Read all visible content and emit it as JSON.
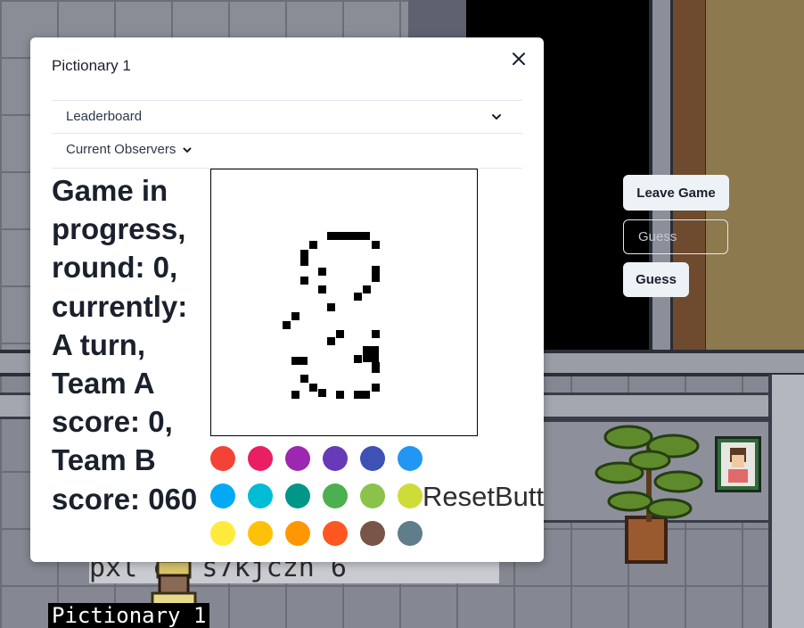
{
  "modal": {
    "title": "Pictionary 1",
    "close_icon": "close-icon",
    "sections": [
      {
        "label": "Leaderboard",
        "icon": "chevron-down-icon"
      },
      {
        "label": "Current Observers",
        "icon": "chevron-down-icon"
      }
    ],
    "status_text": "Game in progress, round: 0, currently: A turn, Team A score: 0, Team B score: 060",
    "palette_colors": [
      "#f44336",
      "#e91e63",
      "#9c27b0",
      "#673ab7",
      "#3f51b5",
      "#2196f3",
      "#03a9f4",
      "#00bcd4",
      "#009688",
      "#4caf50",
      "#8bc34a",
      "#cddc39",
      "#ffeb3b",
      "#ffc107",
      "#ff9800",
      "#ff5722",
      "#795548",
      "#607d8b"
    ],
    "reset_label": "ResetButton"
  },
  "controls": {
    "leave_label": "Leave Game",
    "guess_placeholder": "Guess",
    "guess_label": "Guess"
  },
  "scene": {
    "floor_text": "pxl ez s7kjczn 6",
    "player_label": "Pictionary 1"
  }
}
